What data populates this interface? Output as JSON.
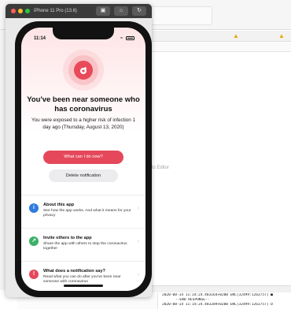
{
  "simulator": {
    "title": "iPhone 11 Pro (13.6)",
    "tool_icons": [
      "screenshot-icon",
      "home-icon",
      "rotate-icon"
    ]
  },
  "xcode": {
    "no_editor": "No Editor",
    "console_lines": [
      "2020-08-14 11:14:24.483164+0200 ENC[32499:1263757] ■",
      "--END RESPONSE--",
      "2020-08-14 11:14:24.483289+0200 ENC[32499:1263757] 0"
    ]
  },
  "status_bar": {
    "time": "11:14"
  },
  "exposure": {
    "headline": "You've been near someone who has coronavirus",
    "body": "You were exposed to a higher risk of infection 1 day ago (Thursday, August 13, 2020)",
    "primary_button": "What can I do now?",
    "secondary_button": "Delete notification"
  },
  "list": [
    {
      "title": "About this app",
      "description": "See how the app works. And what it means for your privacy",
      "icon": "info-icon",
      "color": "#2f7bdd"
    },
    {
      "title": "Invite others to the app",
      "description": "Share the app with others to stop the coronavirus together",
      "icon": "share-icon",
      "color": "#3bb167"
    },
    {
      "title": "What does a notification say?",
      "description": "Read what you can do after you've been near someone with coronavirus",
      "icon": "alert-icon",
      "color": "#e5485b"
    }
  ],
  "colors": {
    "accent": "#e5485b",
    "info": "#2f7bdd",
    "success": "#3bb167"
  }
}
